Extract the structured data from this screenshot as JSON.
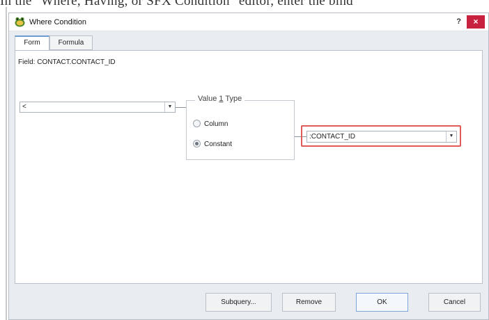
{
  "page_caption": "In the \"Where, Having, or SFX Condition\" editor, enter the bind",
  "dialog": {
    "title": "Where Condition",
    "help": "?",
    "close": "×",
    "icon": "app-frog-icon"
  },
  "tabs": [
    {
      "label": "Form",
      "active": true
    },
    {
      "label": "Formula",
      "active": false
    }
  ],
  "form": {
    "field_label": "Field: CONTACT.CONTACT_ID",
    "operator_value": "<",
    "value_type_group": {
      "title_prefix": "Value ",
      "title_mnemonic": "1",
      "title_suffix": " Type",
      "options": [
        {
          "label": "Column",
          "selected": false
        },
        {
          "label": "Constant",
          "selected": true
        }
      ]
    },
    "constant_value": ":CONTACT_ID"
  },
  "buttons": {
    "subquery": "Subquery...",
    "remove": "Remove",
    "ok": "OK",
    "cancel": "Cancel"
  },
  "colors": {
    "close_button": "#c7213e",
    "highlight_box": "#e05a5a",
    "tab_accent": "#6a9bd1"
  }
}
